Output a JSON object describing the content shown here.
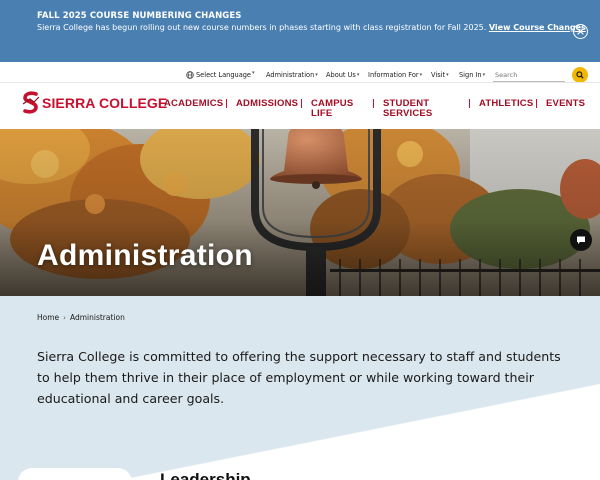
{
  "alert": {
    "title": "FALL 2025 COURSE NUMBERING CHANGES",
    "message": "Sierra College has begun rolling out new course numbers in phases starting with class registration for Fall 2025.",
    "link_label": "View Course Changes",
    "close_icon": "close-icon"
  },
  "utility": {
    "language_label": "Select Language",
    "items": [
      "Administration",
      "About Us",
      "Information For",
      "Visit",
      "Sign In"
    ],
    "search_placeholder": "Search"
  },
  "logo": {
    "text": "SIERRA COLLEGE"
  },
  "nav": {
    "items": [
      "ACADEMICS",
      "ADMISSIONS",
      "CAMPUS",
      "LIFE",
      "STUDENT",
      "SERVICES",
      "ATHLETICS",
      "EVENTS"
    ]
  },
  "hero": {
    "title": "Administration"
  },
  "breadcrumb": {
    "home": "Home",
    "current": "Administration"
  },
  "intro": {
    "text": "Sierra College is committed to offering the support necessary to staff and students to help them thrive in their place of employment or while working toward their educational and career goals."
  },
  "section": {
    "heading": "Leadership"
  },
  "colors": {
    "banner": "#4a7fb2",
    "brand_red": "#c8102e",
    "accent_gold": "#f2b705",
    "intro_bg": "#dbe7ee"
  }
}
